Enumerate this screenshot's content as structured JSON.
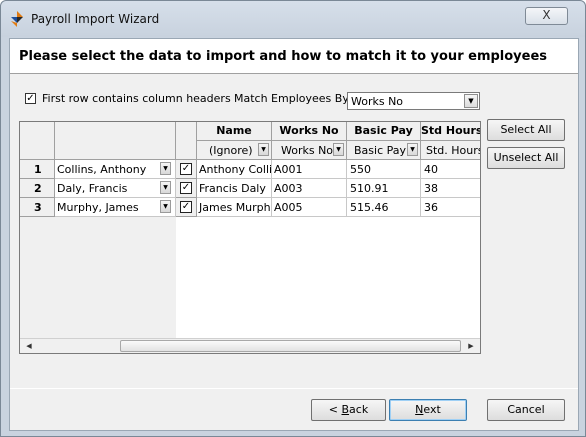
{
  "window": {
    "title": "Payroll Import Wizard",
    "close_glyph": "X"
  },
  "header": {
    "text": "Please select the data to import and how to match it to your employees"
  },
  "options": {
    "first_row_label": "First row contains column headers",
    "first_row_checked": "✓",
    "match_label": "Match Employees By",
    "match_value": "Works No"
  },
  "grid": {
    "header_row": {
      "col_name": "Name",
      "col_works": "Works No",
      "col_basic": "Basic Pay",
      "col_std": "Std Hours"
    },
    "mapping_row": {
      "name_map": "(Ignore)",
      "works_map": "Works No",
      "basic_map": "Basic Pay",
      "std_map": "Std. Hours"
    },
    "rows": [
      {
        "num": "1",
        "employee": "Collins, Anthony",
        "check": "✓",
        "name": "Anthony Collins",
        "works": "A001",
        "basic": "550",
        "std": "40"
      },
      {
        "num": "2",
        "employee": "Daly, Francis",
        "check": "✓",
        "name": "Francis Daly",
        "works": "A003",
        "basic": "510.91",
        "std": "38"
      },
      {
        "num": "3",
        "employee": "Murphy, James",
        "check": "✓",
        "name": "James Murphy",
        "works": "A005",
        "basic": "515.46",
        "std": "36"
      }
    ]
  },
  "side_buttons": {
    "select_all": "Select All",
    "unselect_all": "Unselect All"
  },
  "footer": {
    "back_prefix": "< ",
    "back_u": "B",
    "back_rest": "ack",
    "next_u": "N",
    "next_rest": "ext",
    "cancel": "Cancel"
  },
  "icons": {
    "dropdown": "chevron-down-icon",
    "scroll_left": "arrow-left-icon",
    "scroll_right": "arrow-right-icon"
  },
  "colors": {
    "accent": "#3c7fb1",
    "logo_a": "#e07a10",
    "logo_b": "#1e4f9c"
  }
}
